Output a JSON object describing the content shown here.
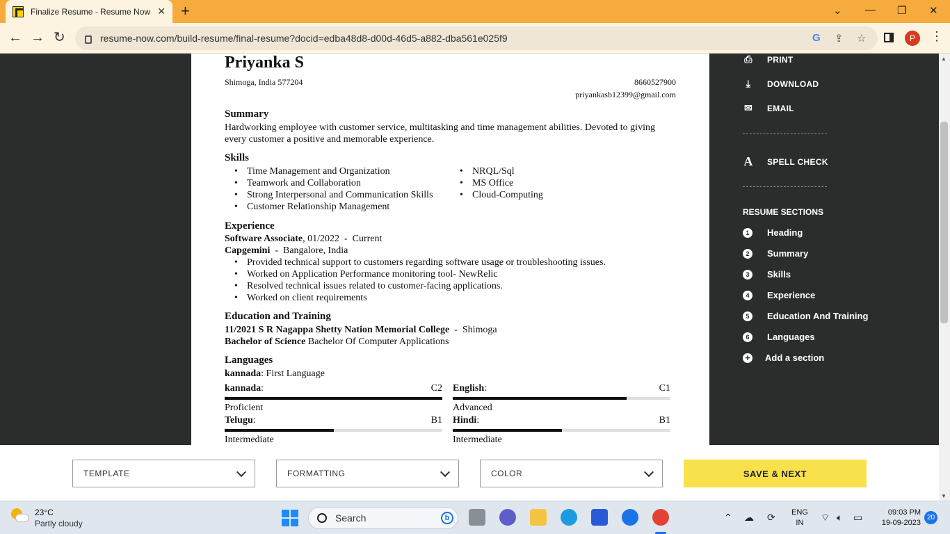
{
  "browser": {
    "tab_title": "Finalize Resume - Resume Now",
    "tab_close": "✕",
    "new_tab": "+",
    "url": "resume-now.com/build-resume/final-resume?docid=edba48d8-d00d-46d5-a882-dba561e025f9",
    "profile_initial": "P"
  },
  "resume": {
    "name": "Priyanka S",
    "location": "Shimoga, India 577204",
    "phone": "8660527900",
    "email": "priyankasb12399@gmail.com",
    "summary_title": "Summary",
    "summary_line1": "Hardworking employee with customer service, multitasking and time management abilities. Devoted to giving",
    "summary_line2": "every customer a positive and memorable experience.",
    "skills_title": "Skills",
    "skills_left": [
      "Time Management and Organization",
      "Teamwork and Collaboration",
      "Strong Interpersonal and Communication Skills",
      "Customer Relationship Management"
    ],
    "skills_right": [
      "NRQL/Sql",
      "MS Office",
      "Cloud-Computing"
    ],
    "experience_title": "Experience",
    "job_title": "Software Associate",
    "job_dates": ", 01/2022  -  Current",
    "company": "Capgemini",
    "company_loc": "  -  Bangalore, India",
    "job_bullets": [
      "Provided technical support to customers regarding software usage or troubleshooting issues.",
      "Worked on Application Performance monitoring tool- NewRelic",
      "Resolved technical issues related to customer-facing applications.",
      "Worked on client requirements"
    ],
    "education_title": "Education and Training",
    "edu_school": "11/2021 S R Nagappa Shetty Nation Memorial College",
    "edu_loc": "  -  Shimoga",
    "edu_degree": "Bachelor of Science",
    "edu_field": " Bachelor Of Computer Applications",
    "languages_title": "Languages",
    "first_lang_name": "kannada",
    "first_lang_desc": ": First Language",
    "languages": [
      {
        "name": "kannada",
        "code": "C2",
        "level": "Proficient",
        "proficiency": 1.0
      },
      {
        "name": "English",
        "code": "C1",
        "level": "Advanced",
        "proficiency": 0.8
      },
      {
        "name": "Telugu",
        "code": "B1",
        "level": "Intermediate",
        "proficiency": 0.5
      },
      {
        "name": "Hindi",
        "code": "B1",
        "level": "Intermediate",
        "proficiency": 0.5
      }
    ]
  },
  "panel": {
    "print": "PRINT",
    "download": "DOWNLOAD",
    "email": "EMAIL",
    "spell_check": "SPELL CHECK",
    "sections_title": "RESUME SECTIONS",
    "sections": [
      "Heading",
      "Summary",
      "Skills",
      "Experience",
      "Education And Training",
      "Languages"
    ],
    "add_section": "Add a section"
  },
  "bottom": {
    "template": "TEMPLATE",
    "formatting": "FORMATTING",
    "color": "COLOR",
    "save_next": "SAVE & NEXT"
  },
  "taskbar": {
    "temp": "23°C",
    "condition": "Partly cloudy",
    "search": "Search",
    "lang1": "ENG",
    "lang2": "IN",
    "time": "09:03 PM",
    "date": "19-09-2023",
    "notifications": "20"
  }
}
